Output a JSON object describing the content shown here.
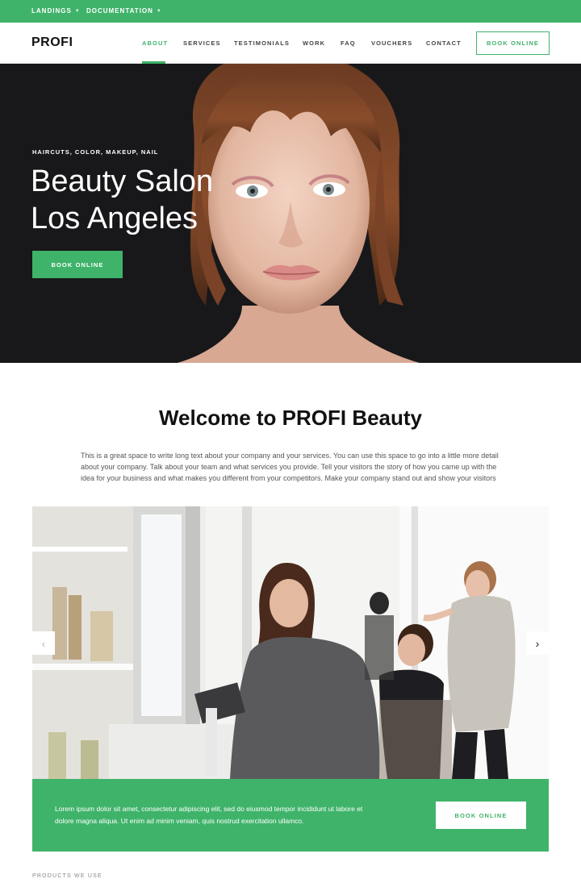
{
  "topbar": {
    "items": [
      {
        "label": "LANDINGS"
      },
      {
        "label": "DOCUMENTATION"
      }
    ]
  },
  "header": {
    "logo": "PROFI",
    "nav": [
      {
        "label": "ABOUT",
        "active": true
      },
      {
        "label": "SERVICES"
      },
      {
        "label": "TESTIMONIALS"
      },
      {
        "label": "WORK"
      },
      {
        "label": "FAQ"
      },
      {
        "label": "VOUCHERS"
      },
      {
        "label": "CONTACT"
      }
    ],
    "cta_label": "BOOK ONLINE"
  },
  "hero": {
    "eyebrow": "HAIRCUTS, COLOR, MAKEUP, NAIL",
    "title_line1": "Beauty Salon",
    "title_line2": "Los Angeles",
    "button_label": "BOOK ONLINE"
  },
  "welcome": {
    "title": "Welcome to PROFI Beauty",
    "text": "This is a great space to write long text about your company and your services. You can use this space to go into a little more detail about your company. Talk about your team and what services you provide. Tell your visitors the story of how you came up with the idea for your business and what makes you different from your competitors. Make your company stand out and show your visitors"
  },
  "carousel": {
    "prev_icon": "chevron-left-icon",
    "next_icon": "chevron-right-icon"
  },
  "cta_band": {
    "text": "Lorem ipsum dolor sit amet, consectetur adipiscing elit, sed do eiusmod tempor incididunt ut labore et dolore magna aliqua. Ut enim ad minim veniam, quis nostrud exercitation ullamco.",
    "button_label": "BOOK ONLINE"
  },
  "products": {
    "label": "PRODUCTS WE USE"
  },
  "colors": {
    "accent": "#3fb36a",
    "hero_bg": "#1a1a1c"
  }
}
